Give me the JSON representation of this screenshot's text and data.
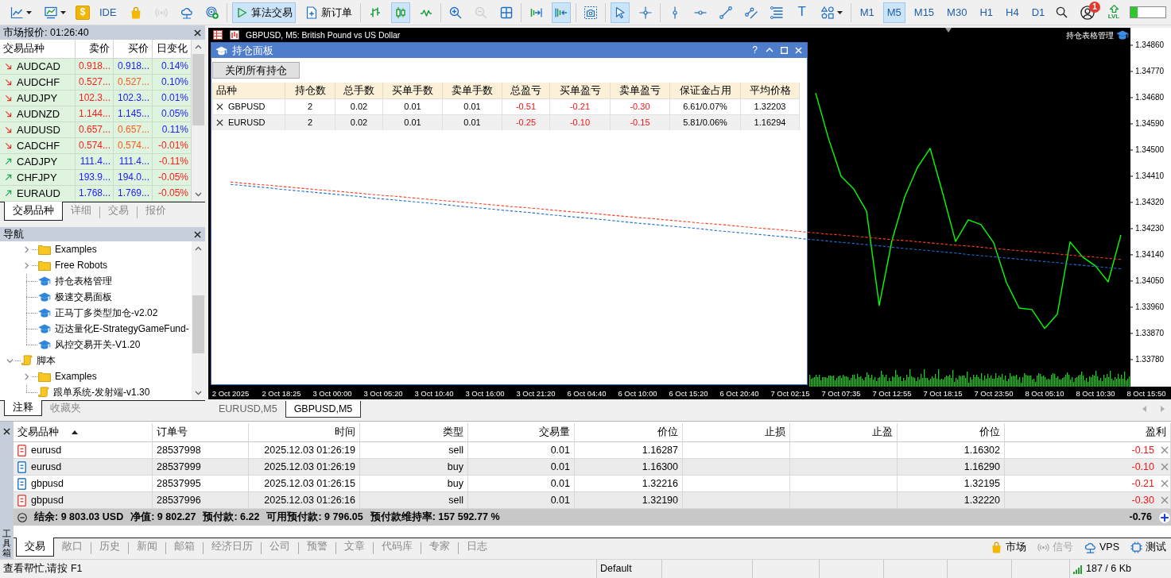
{
  "toolbar": {
    "tool_groups": [
      [
        {
          "active": false,
          "disabled": false
        },
        {
          "active": false,
          "disabled": false
        },
        {
          "label": "$",
          "active": false,
          "disabled": false
        },
        {
          "label": "IDE",
          "active": false,
          "disabled": false
        },
        {
          "active": false,
          "disabled": false
        },
        {
          "active": false,
          "disabled": true
        },
        {
          "active": false,
          "disabled": false
        },
        {
          "active": false,
          "disabled": false
        }
      ],
      [
        {
          "label": "算法交易",
          "active": true,
          "disabled": false
        },
        {
          "label": "新订单",
          "active": false,
          "disabled": false
        }
      ],
      [
        {
          "active": false,
          "disabled": false
        },
        {
          "active": true,
          "disabled": false
        },
        {
          "active": false,
          "disabled": false
        }
      ],
      [
        {
          "active": false,
          "disabled": false
        },
        {
          "active": false,
          "disabled": true
        },
        {
          "active": false,
          "disabled": false
        }
      ],
      [
        {
          "active": false,
          "disabled": false
        },
        {
          "active": true,
          "disabled": false
        }
      ],
      [
        {
          "active": false,
          "disabled": false
        }
      ],
      [
        {
          "active": true,
          "disabled": false
        },
        {
          "active": false,
          "disabled": false
        }
      ],
      [
        {
          "active": false,
          "disabled": false
        },
        {
          "active": false,
          "disabled": false
        },
        {
          "active": false,
          "disabled": false
        },
        {
          "active": false,
          "disabled": false
        },
        {
          "active": false,
          "disabled": false
        },
        {
          "label": "T",
          "active": false,
          "disabled": false
        },
        {
          "active": false,
          "disabled": false
        }
      ]
    ],
    "timeframes": [
      {
        "label": "M1",
        "selected": false
      },
      {
        "label": "M5",
        "selected": true
      },
      {
        "label": "M15",
        "selected": false
      },
      {
        "label": "M30",
        "selected": false
      },
      {
        "label": "H1",
        "selected": false
      },
      {
        "label": "H4",
        "selected": false
      },
      {
        "label": "D1",
        "selected": false
      }
    ],
    "notification_count": "1",
    "level_label": "LVL",
    "meter": {
      "level": 0.2
    }
  },
  "market_watch": {
    "title": "市场报价: 01:26:40",
    "columns": [
      "交易品种",
      "卖价",
      "买价",
      "日变化"
    ],
    "rows": [
      {
        "symbol": "AUDCAD",
        "rising": false,
        "bid": {
          "text": "0.918...",
          "color": "#ff1a1a"
        },
        "ask": {
          "text": "0.918...",
          "color": "#1a1aff"
        },
        "change": {
          "text": "0.14%",
          "color": "#1a1aff"
        }
      },
      {
        "symbol": "AUDCHF",
        "rising": false,
        "bid": {
          "text": "0.527...",
          "color": "#ff1a1a"
        },
        "ask": {
          "text": "0.527...",
          "color": "#ff5a1a"
        },
        "change": {
          "text": "0.10%",
          "color": "#1a1aff"
        }
      },
      {
        "symbol": "AUDJPY",
        "rising": false,
        "bid": {
          "text": "102.3...",
          "color": "#ff1a1a"
        },
        "ask": {
          "text": "102.3...",
          "color": "#1a1aff"
        },
        "change": {
          "text": "0.01%",
          "color": "#1a1aff"
        }
      },
      {
        "symbol": "AUDNZD",
        "rising": false,
        "bid": {
          "text": "1.144...",
          "color": "#ff1a1a"
        },
        "ask": {
          "text": "1.145...",
          "color": "#1a1aff"
        },
        "change": {
          "text": "0.05%",
          "color": "#1a1aff"
        }
      },
      {
        "symbol": "AUDUSD",
        "rising": false,
        "bid": {
          "text": "0.657...",
          "color": "#ff1a1a"
        },
        "ask": {
          "text": "0.657...",
          "color": "#ff5a1a"
        },
        "change": {
          "text": "0.11%",
          "color": "#1a1aff"
        }
      },
      {
        "symbol": "CADCHF",
        "rising": false,
        "bid": {
          "text": "0.574...",
          "color": "#ff1a1a"
        },
        "ask": {
          "text": "0.574...",
          "color": "#ff5a1a"
        },
        "change": {
          "text": "-0.01%",
          "color": "#ff1a1a"
        }
      },
      {
        "symbol": "CADJPY",
        "rising": true,
        "bid": {
          "text": "111.4...",
          "color": "#1a1aff"
        },
        "ask": {
          "text": "111.4...",
          "color": "#1a1aff"
        },
        "change": {
          "text": "-0.11%",
          "color": "#ff1a1a"
        }
      },
      {
        "symbol": "CHFJPY",
        "rising": true,
        "bid": {
          "text": "193.9...",
          "color": "#1a1aff"
        },
        "ask": {
          "text": "194.0...",
          "color": "#1a1aff"
        },
        "change": {
          "text": "-0.05%",
          "color": "#ff1a1a"
        }
      },
      {
        "symbol": "EURAUD",
        "rising": true,
        "bid": {
          "text": "1.768...",
          "color": "#1a1aff"
        },
        "ask": {
          "text": "1.769...",
          "color": "#1a1aff"
        },
        "change": {
          "text": "-0.05%",
          "color": "#ff1a1a"
        }
      }
    ],
    "tabs": [
      {
        "label": "交易品种",
        "selected": true
      },
      {
        "label": "详细",
        "selected": false
      },
      {
        "label": "交易",
        "selected": false
      },
      {
        "label": "报价",
        "selected": false
      }
    ]
  },
  "navigator": {
    "title": "导航",
    "tree": [
      {
        "children": [
          {
            "label": "Examples",
            "kind": "folder",
            "expanded": false
          },
          {
            "label": "Free Robots",
            "kind": "folder",
            "expanded": false
          },
          {
            "label": "持仓表格管理",
            "kind": "expert"
          },
          {
            "label": "极速交易面板",
            "kind": "expert"
          },
          {
            "label": "正马丁多类型加仓-v2.02",
            "kind": "expert"
          },
          {
            "label": "迈达量化E-StrategyGameFund-",
            "kind": "expert"
          },
          {
            "label": "风控交易开关-V1.20",
            "kind": "expert"
          }
        ]
      },
      {
        "label": "脚本",
        "kind": "script",
        "expanded": true,
        "children": [
          {
            "label": "Examples",
            "kind": "folder",
            "expanded": false
          },
          {
            "label": "跟单系统-发射端-v1.30",
            "kind": "script"
          }
        ]
      }
    ],
    "tabs": [
      {
        "label": "注释",
        "selected": true
      },
      {
        "label": "收藏夹",
        "selected": false
      }
    ]
  },
  "chart": {
    "title": "GBPUSD, M5: British Pound vs US Dollar",
    "expert_label": "持仓表格管理",
    "chart_data": {
      "type": "line",
      "categories": [
        "2 Oct 2025",
        null,
        null,
        null,
        "2 Oct 18:25",
        null,
        null,
        null,
        "3 Oct 00:00",
        null,
        null,
        null,
        "3 Oct 05:20",
        null,
        null,
        null,
        "3 Oct 10:40",
        null,
        null,
        null,
        "3 Oct 16:00",
        null,
        null,
        null,
        "3 Oct 21:20",
        null,
        null,
        null,
        "6 Oct 04:40",
        null,
        null,
        null,
        "6 Oct 10:00",
        null,
        null,
        null,
        "6 Oct 15:20",
        null,
        null,
        null,
        "6 Oct 20:40",
        null,
        null,
        null,
        "7 Oct 02:15",
        null,
        null,
        null,
        "7 Oct 07:35",
        null,
        null,
        null,
        "7 Oct 12:55",
        null,
        null,
        null,
        "7 Oct 18:15",
        null,
        null,
        null,
        "7 Oct 23:50",
        null,
        null,
        null,
        "8 Oct 05:10",
        null,
        null,
        null,
        "8 Oct 10:30",
        null,
        null,
        null,
        "8 Oct 15:50"
      ],
      "series": [
        {
          "color": "#00ff00",
          "line_style": "solid",
          "values": [
            null,
            null,
            null,
            null,
            null,
            null,
            null,
            null,
            null,
            null,
            null,
            null,
            null,
            null,
            null,
            null,
            null,
            null,
            null,
            null,
            null,
            null,
            null,
            null,
            null,
            null,
            null,
            null,
            null,
            null,
            null,
            null,
            null,
            null,
            null,
            null,
            null,
            null,
            null,
            null,
            null,
            null,
            null,
            null,
            null,
            null,
            1.34696,
            1.34541,
            1.3441,
            1.34366,
            1.3429,
            1.33966,
            1.34189,
            1.34339,
            1.3444,
            1.34506,
            1.3435,
            1.34186,
            1.3426,
            1.34244,
            1.34181,
            1.34045,
            1.33957,
            1.33952,
            1.33887,
            1.33936,
            1.34184,
            1.34132,
            1.34102,
            1.34047,
            1.34208,
            null,
            null
          ]
        },
        {
          "color": "#ff3c1e",
          "line_style": "dashed",
          "values": [
            1.3439,
            1.34386,
            1.34382,
            1.34379,
            1.34375,
            1.34371,
            1.34367,
            1.34363,
            1.3436,
            1.34356,
            1.34352,
            1.34348,
            1.34344,
            1.34341,
            1.34337,
            1.34333,
            1.34329,
            1.34325,
            1.34322,
            1.34318,
            1.34314,
            1.3431,
            1.34306,
            1.34303,
            1.34299,
            1.34295,
            1.34291,
            1.34287,
            1.34284,
            1.3428,
            1.34276,
            1.34272,
            1.34268,
            1.34265,
            1.34261,
            1.34257,
            1.34253,
            1.34249,
            1.34246,
            1.34242,
            1.34238,
            1.34234,
            1.3423,
            1.34227,
            1.34223,
            1.34219,
            1.34215,
            1.34211,
            1.34208,
            1.34204,
            1.342,
            1.34196,
            1.34192,
            1.34189,
            1.34185,
            1.34181,
            1.34177,
            1.34173,
            1.3417,
            1.34166,
            1.34162,
            1.34158,
            1.34154,
            1.34151,
            1.34147,
            1.34143,
            1.34139,
            1.34135,
            1.34132,
            1.34128,
            1.34124,
            null,
            null
          ]
        },
        {
          "color": "#1e6ed2",
          "line_style": "dashed",
          "values": [
            1.34382,
            1.34378,
            1.34374,
            1.3437,
            1.34365,
            1.34361,
            1.34357,
            1.34353,
            1.34349,
            1.34345,
            1.34341,
            1.34336,
            1.34332,
            1.34328,
            1.34324,
            1.3432,
            1.34316,
            1.34312,
            1.34307,
            1.34303,
            1.34299,
            1.34295,
            1.34291,
            1.34287,
            1.34283,
            1.34278,
            1.34274,
            1.3427,
            1.34266,
            1.34262,
            1.34258,
            1.34253,
            1.34249,
            1.34245,
            1.34241,
            1.34237,
            1.34233,
            1.34229,
            1.34224,
            1.3422,
            1.34216,
            1.34212,
            1.34208,
            1.34204,
            1.342,
            1.34195,
            1.34191,
            1.34187,
            1.34183,
            1.34179,
            1.34175,
            1.34171,
            1.34166,
            1.34162,
            1.34158,
            1.34154,
            1.3415,
            1.34146,
            1.34141,
            1.34137,
            1.34133,
            1.34129,
            1.34125,
            1.34121,
            1.34117,
            1.34113,
            1.34108,
            1.34104,
            1.341,
            1.34096,
            1.34092,
            null,
            null
          ]
        }
      ],
      "ylim": [
        1.33687,
        1.3492
      ],
      "yticks": [
        {
          "value": 1.3486,
          "label": "1.34860"
        },
        {
          "value": 1.3477,
          "label": "1.34770"
        },
        {
          "value": 1.3468,
          "label": "1.34680"
        },
        {
          "value": 1.3459,
          "label": "1.34590"
        },
        {
          "value": 1.345,
          "label": "1.34500"
        },
        {
          "value": 1.3441,
          "label": "1.34410"
        },
        {
          "value": 1.3432,
          "label": "1.34320"
        },
        {
          "value": 1.3423,
          "label": "1.34230"
        },
        {
          "value": 1.3414,
          "label": "1.34140"
        },
        {
          "value": 1.3405,
          "label": "1.34050"
        },
        {
          "value": 1.3396,
          "label": "1.33960"
        },
        {
          "value": 1.3387,
          "label": "1.33870"
        },
        {
          "value": 1.3378,
          "label": "1.33780"
        }
      ]
    },
    "position_panel": {
      "title": "持仓面板",
      "help": "?",
      "close_all_button": "关闭所有持仓",
      "columns": [
        {
          "label": "品种",
          "kind": "symbol"
        },
        {
          "label": "持仓数",
          "kind": "value"
        },
        {
          "label": "总手数",
          "kind": "value"
        },
        {
          "label": "买单手数",
          "kind": "value"
        },
        {
          "label": "卖单手数",
          "kind": "value"
        },
        {
          "label": "总盈亏",
          "kind": "pnl"
        },
        {
          "label": "买单盈亏",
          "kind": "pnl"
        },
        {
          "label": "卖单盈亏",
          "kind": "pnl"
        },
        {
          "label": "保证金占用",
          "kind": "value"
        },
        {
          "label": "平均价格",
          "kind": "value"
        }
      ],
      "rows": [
        [
          "GBPUSD",
          "2",
          "0.02",
          "0.01",
          "0.01",
          "-0.51",
          "-0.21",
          "-0.30",
          "6.61/0.07%",
          "1.32203"
        ],
        [
          "EURUSD",
          "2",
          "0.02",
          "0.01",
          "0.01",
          "-0.25",
          "-0.10",
          "-0.15",
          "5.81/0.06%",
          "1.16294"
        ]
      ]
    },
    "tabs": [
      {
        "label": "EURUSD,M5",
        "selected": false
      },
      {
        "label": "GBPUSD,M5",
        "selected": true
      }
    ]
  },
  "toolbox": {
    "title": "工具箱",
    "columns": [
      {
        "label": "交易品种",
        "kind": "symbol",
        "sorted": true
      },
      {
        "label": "订单号",
        "kind": "text",
        "sorted": false
      },
      {
        "label": "时间",
        "kind": "value",
        "sorted": false
      },
      {
        "label": "类型",
        "kind": "value",
        "sorted": false
      },
      {
        "label": "交易量",
        "kind": "value",
        "sorted": false
      },
      {
        "label": "价位",
        "kind": "value",
        "sorted": false
      },
      {
        "label": "止损",
        "kind": "value",
        "sorted": false
      },
      {
        "label": "止盈",
        "kind": "value",
        "sorted": false
      },
      {
        "label": "价位",
        "kind": "value",
        "sorted": false
      },
      {
        "label": "盈利",
        "kind": "pnl",
        "sorted": false
      }
    ],
    "rows": [
      {
        "color": "#e2504a",
        "symbol": "eurusd",
        "order": "28537998",
        "time": "2025.12.03 01:26:19",
        "type": "sell",
        "volume": "0.01",
        "open_price": "1.16287",
        "current_price": "1.16302",
        "profit": "-0.15"
      },
      {
        "color": "#2f7cc4",
        "symbol": "eurusd",
        "order": "28537999",
        "time": "2025.12.03 01:26:19",
        "type": "buy",
        "volume": "0.01",
        "open_price": "1.16300",
        "current_price": "1.16290",
        "profit": "-0.10"
      },
      {
        "color": "#2f7cc4",
        "symbol": "gbpusd",
        "order": "28537995",
        "time": "2025.12.03 01:26:15",
        "type": "buy",
        "volume": "0.01",
        "open_price": "1.32216",
        "current_price": "1.32195",
        "profit": "-0.21"
      },
      {
        "color": "#e2504a",
        "symbol": "gbpusd",
        "order": "28537996",
        "time": "2025.12.03 01:26:16",
        "type": "sell",
        "volume": "0.01",
        "open_price": "1.32190",
        "current_price": "1.32220",
        "profit": "-0.30"
      }
    ],
    "summary": {
      "expanded": true,
      "items": [
        "结余: 9 803.03 USD",
        "净值: 9 802.27",
        "预付款: 6.22",
        "可用预付款: 9 796.05",
        "预付款维持率: 157 592.77 %"
      ],
      "total": "-0.76"
    },
    "tabs": [
      {
        "label": "交易",
        "selected": true
      },
      {
        "label": "敞口",
        "selected": false
      },
      {
        "label": "历史",
        "selected": false
      },
      {
        "label": "新闻",
        "selected": false
      },
      {
        "label": "邮箱",
        "selected": false
      },
      {
        "label": "经济日历",
        "selected": false
      },
      {
        "label": "公司",
        "selected": false
      },
      {
        "label": "预警",
        "selected": false
      },
      {
        "label": "文章",
        "selected": false
      },
      {
        "label": "代码库",
        "selected": false
      },
      {
        "label": "专家",
        "selected": false
      },
      {
        "label": "日志",
        "selected": false
      }
    ],
    "links": [
      {
        "label": "市场",
        "disabled": false
      },
      {
        "label": "信号",
        "disabled": true
      },
      {
        "label": "VPS",
        "disabled": false
      },
      {
        "label": "测试",
        "disabled": false
      }
    ]
  },
  "status_bar": {
    "hint": "查看帮忙,请按 F1",
    "profile": "Default",
    "traffic": "187 / 6 Kb"
  }
}
